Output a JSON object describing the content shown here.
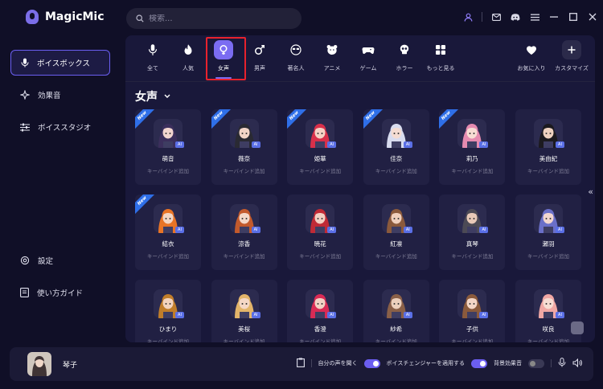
{
  "app": {
    "name": "MagicMic"
  },
  "search": {
    "placeholder": "検索..."
  },
  "titlebar_icons": [
    "user-icon",
    "mail-icon",
    "discord-icon",
    "menu-icon",
    "minimize-icon",
    "maximize-icon",
    "close-icon"
  ],
  "sidebar": {
    "items": [
      {
        "label": "ボイスボックス",
        "icon": "microphone-icon",
        "active": true
      },
      {
        "label": "効果音",
        "icon": "sparkle-icon",
        "active": false
      },
      {
        "label": "ボイススタジオ",
        "icon": "sliders-icon",
        "active": false
      },
      {
        "label": "設定",
        "icon": "gear-icon",
        "active": false
      },
      {
        "label": "使い方ガイド",
        "icon": "book-icon",
        "active": false
      }
    ],
    "bottom_icons": [
      "gift-icon",
      "edit-icon",
      "chat-icon",
      "feedback-icon"
    ]
  },
  "categories": [
    {
      "label": "全て",
      "icon": "microphone-icon"
    },
    {
      "label": "人気",
      "icon": "fire-icon"
    },
    {
      "label": "女声",
      "icon": "female-icon",
      "selected": true
    },
    {
      "label": "男声",
      "icon": "male-icon"
    },
    {
      "label": "著名人",
      "icon": "sunglasses-icon"
    },
    {
      "label": "アニメ",
      "icon": "bear-icon"
    },
    {
      "label": "ゲーム",
      "icon": "gamepad-icon"
    },
    {
      "label": "ホラー",
      "icon": "skull-icon"
    },
    {
      "label": "もっと見る",
      "icon": "grid-icon"
    }
  ],
  "categories_right": [
    {
      "label": "お気に入り",
      "icon": "heart-icon"
    },
    {
      "label": "カスタマイズ",
      "icon": "plus-icon"
    }
  ],
  "section": {
    "title": "女声"
  },
  "voices": [
    {
      "name": "萌音",
      "keyword": "キーバインド追加",
      "new": true,
      "hair": "#3b2f5c",
      "skin": "#f2d6cf"
    },
    {
      "name": "薇奈",
      "keyword": "キーバインド追加",
      "new": true,
      "hair": "#2a2a33",
      "skin": "#f1d4c6"
    },
    {
      "name": "姫華",
      "keyword": "キーバインド追加",
      "new": true,
      "hair": "#d8304a",
      "skin": "#f5d2c4"
    },
    {
      "name": "佳奈",
      "keyword": "キーバインド追加",
      "new": true,
      "hair": "#d8dcef",
      "skin": "#f4dcd2"
    },
    {
      "name": "莉乃",
      "keyword": "キーバインド追加",
      "new": true,
      "hair": "#e58bb0",
      "skin": "#f7ddd4"
    },
    {
      "name": "美由紀",
      "keyword": "キーバインド追加",
      "new": false,
      "hair": "#1c1a1f",
      "skin": "#efd2c0"
    },
    {
      "name": "結衣",
      "keyword": "キーバインド追加",
      "new": true,
      "hair": "#e87426",
      "skin": "#f3d6c4"
    },
    {
      "name": "涼香",
      "keyword": "キーバインド追加",
      "new": false,
      "hair": "#c35a2c",
      "skin": "#f4d8c8"
    },
    {
      "name": "暁花",
      "keyword": "キーバインド追加",
      "new": false,
      "hair": "#c02a36",
      "skin": "#f2cfc2"
    },
    {
      "name": "紅凛",
      "keyword": "キーバインド追加",
      "new": false,
      "hair": "#8b5a3c",
      "skin": "#f0d0bd"
    },
    {
      "name": "真琴",
      "keyword": "キーバインド追加",
      "new": false,
      "hair": "#4c4a55",
      "skin": "#e8c9b8"
    },
    {
      "name": "瀬羽",
      "keyword": "キーバインド追加",
      "new": false,
      "hair": "#6a6fc8",
      "skin": "#f2d6cf"
    },
    {
      "name": "ひまり",
      "keyword": "キーバインド追加",
      "new": false,
      "hair": "#c07d2a",
      "skin": "#f3d3bd"
    },
    {
      "name": "美桜",
      "keyword": "キーバインド追加",
      "new": false,
      "hair": "#e3b56a",
      "skin": "#f5d8c6"
    },
    {
      "name": "香澄",
      "keyword": "キーバインド追加",
      "new": false,
      "hair": "#d92b55",
      "skin": "#f2d2c4"
    },
    {
      "name": "紗希",
      "keyword": "キーバインド追加",
      "new": false,
      "hair": "#8a6048",
      "skin": "#ecd0bd"
    },
    {
      "name": "子供",
      "keyword": "キーバインド追加",
      "new": false,
      "hair": "#8a5a3c",
      "skin": "#f4d6c6"
    },
    {
      "name": "咲良",
      "keyword": "キーバインド追加",
      "new": false,
      "hair": "#f0a7a4",
      "skin": "#f7ddd3"
    }
  ],
  "ai_badge": "AI",
  "new_badge": "New",
  "bottom": {
    "current_voice": "琴子",
    "hear_own_voice": "自分の声を聞く",
    "apply_changer": "ボイスチェンジャーを適用する",
    "bg_sound": "背景効果音"
  }
}
